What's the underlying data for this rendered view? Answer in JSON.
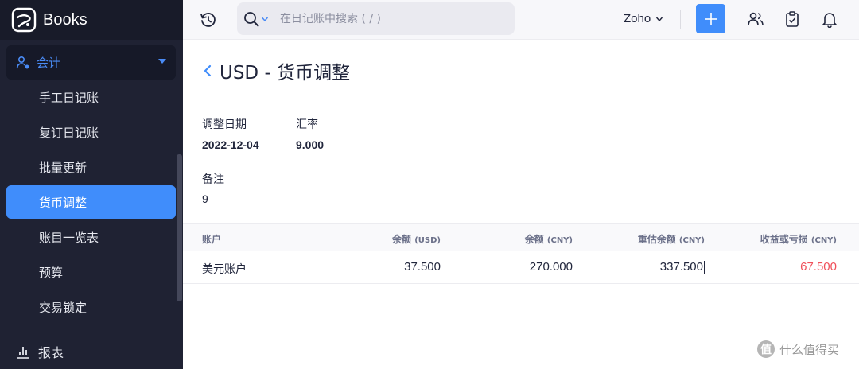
{
  "app": {
    "name": "Books"
  },
  "sidebar": {
    "section": {
      "label": "会计"
    },
    "items": [
      {
        "label": "手工日记账"
      },
      {
        "label": "复订日记账"
      },
      {
        "label": "批量更新"
      },
      {
        "label": "货币调整",
        "active": true
      },
      {
        "label": "账目一览表"
      },
      {
        "label": "预算"
      },
      {
        "label": "交易锁定"
      }
    ],
    "reports": {
      "label": "报表"
    }
  },
  "topbar": {
    "search_placeholder": "在日记账中搜索 ( / )",
    "org_name": "Zoho",
    "icons": [
      "history-icon",
      "search-icon",
      "add-icon",
      "users-icon",
      "checklist-icon",
      "bell-icon"
    ]
  },
  "page": {
    "title": "USD - 货币调整",
    "fields": {
      "adjust_date_label": "调整日期",
      "adjust_date_value": "2022-12-04",
      "exchange_rate_label": "汇率",
      "exchange_rate_value": "9.000",
      "notes_label": "备注",
      "notes_value": "9"
    }
  },
  "table": {
    "headers": [
      {
        "label": "账户",
        "unit": ""
      },
      {
        "label": "余额",
        "unit": "(USD)"
      },
      {
        "label": "余额",
        "unit": "(CNY)"
      },
      {
        "label": "重估余额",
        "unit": "(CNY)"
      },
      {
        "label": "收益或亏损",
        "unit": "(CNY)"
      }
    ],
    "rows": [
      {
        "account": "美元账户",
        "balance_usd": "37.500",
        "balance_cny": "270.000",
        "revalued_cny": "337.500",
        "gain_loss_cny": "67.500"
      }
    ]
  },
  "watermark": {
    "badge": "值",
    "text": "什么值得买"
  },
  "colors": {
    "accent": "#408dfb",
    "sidebar_bg": "#1f2233",
    "loss": "#f0505a"
  }
}
